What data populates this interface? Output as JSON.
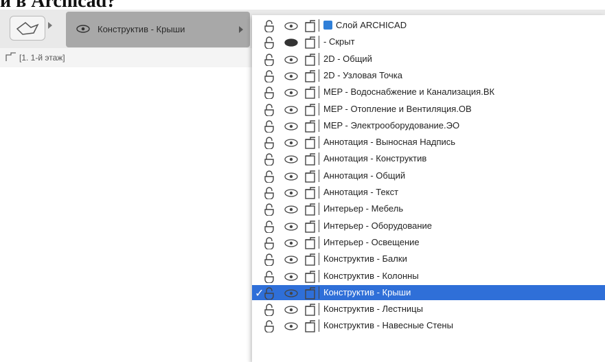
{
  "heading": "и в Archicad?",
  "toolbar": {
    "layer_combo_label": "Конструктив - Крыши"
  },
  "story": {
    "label": "[1. 1-й этаж]"
  },
  "menu": {
    "items": [
      {
        "label": "Слой ARCHICAD",
        "selected": false,
        "hidden": false
      },
      {
        "label": "- Скрыт",
        "selected": false,
        "hidden": true
      },
      {
        "label": "2D - Общий",
        "selected": false,
        "hidden": false
      },
      {
        "label": "2D - Узловая Точка",
        "selected": false,
        "hidden": false
      },
      {
        "label": "MEP - Водоснабжение и Канализация.ВК",
        "selected": false,
        "hidden": false
      },
      {
        "label": "MEP - Отопление и Вентиляция.ОВ",
        "selected": false,
        "hidden": false
      },
      {
        "label": "MEP - Электрооборудование.ЭО",
        "selected": false,
        "hidden": false
      },
      {
        "label": "Аннотация - Выносная Надпись",
        "selected": false,
        "hidden": false
      },
      {
        "label": "Аннотация - Конструктив",
        "selected": false,
        "hidden": false
      },
      {
        "label": "Аннотация - Общий",
        "selected": false,
        "hidden": false
      },
      {
        "label": "Аннотация - Текст",
        "selected": false,
        "hidden": false
      },
      {
        "label": "Интерьер - Мебель",
        "selected": false,
        "hidden": false
      },
      {
        "label": "Интерьер - Оборудование",
        "selected": false,
        "hidden": false
      },
      {
        "label": "Интерьер - Освещение",
        "selected": false,
        "hidden": false
      },
      {
        "label": "Конструктив - Балки",
        "selected": false,
        "hidden": false
      },
      {
        "label": "Конструктив - Колонны",
        "selected": false,
        "hidden": false
      },
      {
        "label": "Конструктив - Крыши",
        "selected": true,
        "hidden": false
      },
      {
        "label": "Конструктив - Лестницы",
        "selected": false,
        "hidden": false
      },
      {
        "label": "Конструктив - Навесные Стены",
        "selected": false,
        "hidden": false
      }
    ],
    "check_mark": "✓"
  },
  "colors": {
    "selection": "#2f6fd8",
    "toolbar_bg": "#e9e9e9"
  }
}
